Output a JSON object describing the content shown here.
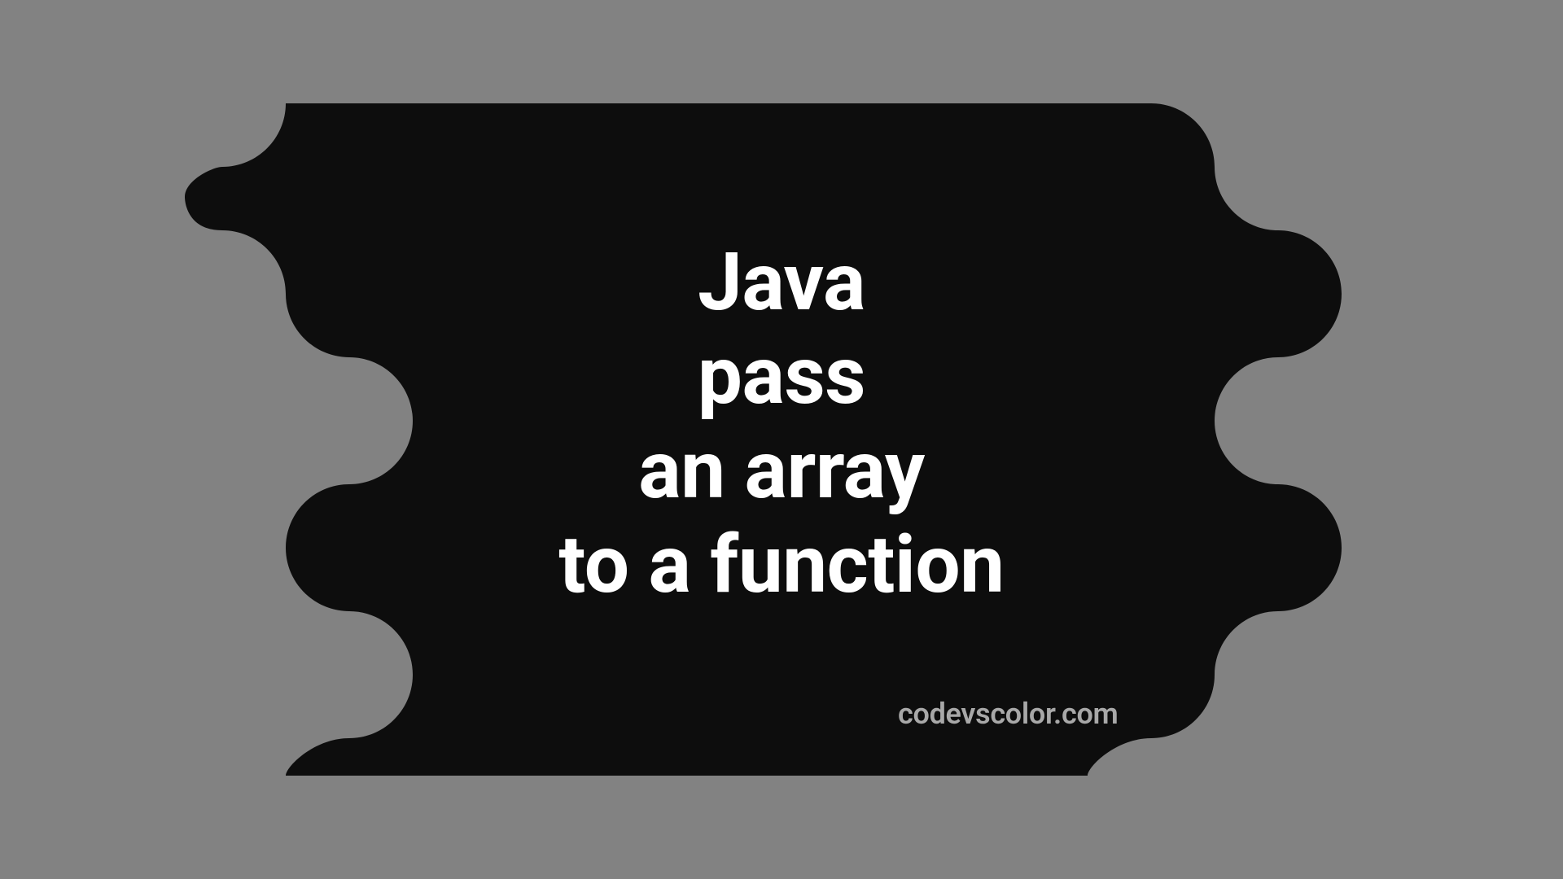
{
  "title": {
    "line1": "Java",
    "line2": "pass",
    "line3": "an array",
    "line4": "to a function"
  },
  "watermark": "codevscolor.com",
  "colors": {
    "background": "#828282",
    "shape": "#0d0d0d",
    "text": "#ffffff",
    "watermark": "#a8a8a8"
  }
}
